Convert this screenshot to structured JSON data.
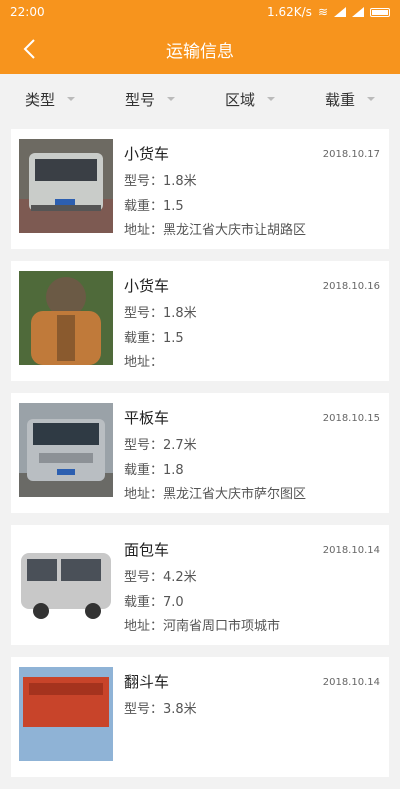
{
  "status": {
    "time": "22:00",
    "speed": "1.62K/s"
  },
  "header": {
    "title": "运输信息"
  },
  "filters": [
    {
      "label": "类型"
    },
    {
      "label": "型号"
    },
    {
      "label": "区域"
    },
    {
      "label": "载重"
    }
  ],
  "items": [
    {
      "name": "小货车",
      "date": "2018.10.17",
      "model": "型号：1.8米",
      "load": "载重：1.5",
      "address": "地址：黑龙江省大庆市让胡路区"
    },
    {
      "name": "小货车",
      "date": "2018.10.16",
      "model": "型号：1.8米",
      "load": "载重：1.5",
      "address": "地址："
    },
    {
      "name": "平板车",
      "date": "2018.10.15",
      "model": "型号：2.7米",
      "load": "载重：1.8",
      "address": "地址：黑龙江省大庆市萨尔图区"
    },
    {
      "name": "面包车",
      "date": "2018.10.14",
      "model": "型号：4.2米",
      "load": "载重：7.0",
      "address": "地址：河南省周口市项城市"
    },
    {
      "name": "翻斗车",
      "date": "2018.10.14",
      "model": "型号：3.8米",
      "load": "",
      "address": ""
    }
  ]
}
